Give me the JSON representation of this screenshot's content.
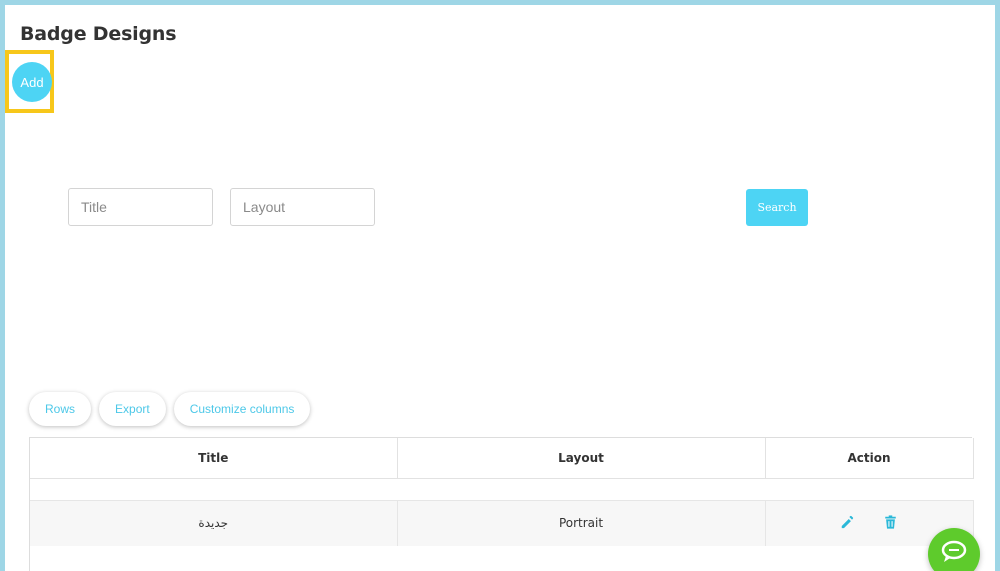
{
  "page": {
    "title": "Badge Designs"
  },
  "actions": {
    "add_label": "Add"
  },
  "filters": {
    "title_placeholder": "Title",
    "layout_placeholder": "Layout",
    "search_label": "Search"
  },
  "toolbar": {
    "rows_label": "Rows",
    "export_label": "Export",
    "customize_label": "Customize columns"
  },
  "table": {
    "headers": [
      "Title",
      "Layout",
      "Action"
    ],
    "rows": [
      {
        "title": "جديدة",
        "layout": "Portrait"
      }
    ]
  },
  "icons": {
    "edit": "pencil-icon",
    "delete": "trash-icon",
    "chat": "chat-bubble-icon"
  },
  "colors": {
    "accent": "#4dd4f4",
    "highlight": "#f7c71a",
    "frame": "#9ed6e6",
    "chat": "#5ecb2c"
  }
}
